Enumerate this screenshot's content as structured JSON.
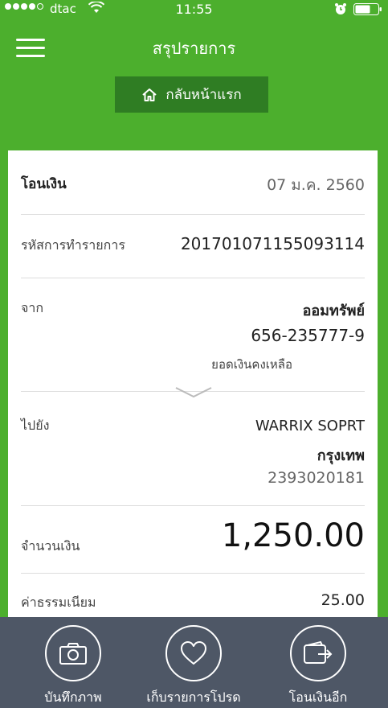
{
  "status_bar": {
    "carrier": "dtac",
    "time": "11:55",
    "icons": [
      "signal-dots-icon",
      "wifi-icon",
      "alarm-icon",
      "battery-icon"
    ]
  },
  "header": {
    "title": "สรุปรายการ",
    "home_button": "กลับหน้าแรก"
  },
  "transaction": {
    "type_label": "โอนเงิน",
    "date": "07 ม.ค. 2560",
    "ref_label": "รหัสการทำรายการ",
    "ref_value": "201701071155093114",
    "from_label": "จาก",
    "from_account_name": "ออมทรัพย์",
    "from_account_number": "656-235777-9",
    "balance_label": "ยอดเงินคงเหลือ",
    "to_label": "ไปยัง",
    "to_name": "WARRIX SOPRT",
    "to_bank": "กรุงเทพ",
    "to_account_number": "2393020181",
    "amount_label": "จำนวนเงิน",
    "amount_value": "1,250.00",
    "fee_label": "ค่าธรรมเนียม",
    "fee_value": "25.00"
  },
  "bottom_actions": [
    {
      "label": "บันทึกภาพ",
      "icon": "camera-icon"
    },
    {
      "label": "เก็บรายการโปรด",
      "icon": "heart-icon"
    },
    {
      "label": "โอนเงินอีก",
      "icon": "wallet-transfer-icon"
    }
  ],
  "colors": {
    "primary_green": "#4caf2d",
    "dark_green_button": "#2f7d23",
    "bottom_bar": "#4e5766"
  }
}
